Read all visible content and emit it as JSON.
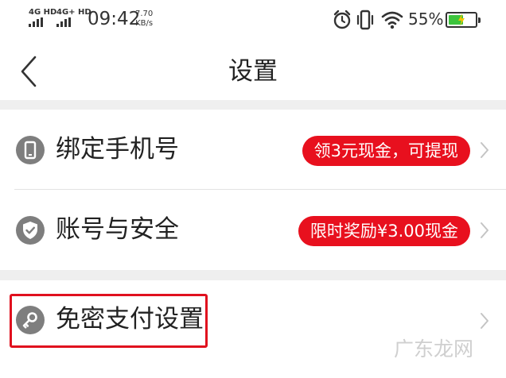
{
  "status_bar": {
    "network_1": "4G HD",
    "network_2": "4G+ HD",
    "time": "09:42",
    "speed_value": "7.70",
    "speed_unit": "KB/s",
    "battery_percent": "55%",
    "battery_level": 0.55,
    "icons": [
      "alarm-icon",
      "vibrate-icon",
      "wifi-icon",
      "battery-icon"
    ]
  },
  "nav": {
    "title": "设置",
    "back_icon": "chevron-left-icon"
  },
  "settings": {
    "items": [
      {
        "label": "绑定手机号",
        "badge": "领3元现金，可提现",
        "icon": "phone-icon"
      },
      {
        "label": "账号与安全",
        "badge": "限时奖励¥3.00现金",
        "icon": "shield-check-icon"
      },
      {
        "label": "免密支付设置",
        "badge": "",
        "icon": "key-icon",
        "highlighted": true
      }
    ]
  },
  "colors": {
    "badge": "#e8101e",
    "highlight": "#e0101e",
    "icon_bg": "#7e7e7e",
    "page_bg": "#efefef"
  },
  "watermark": "广东龙网"
}
